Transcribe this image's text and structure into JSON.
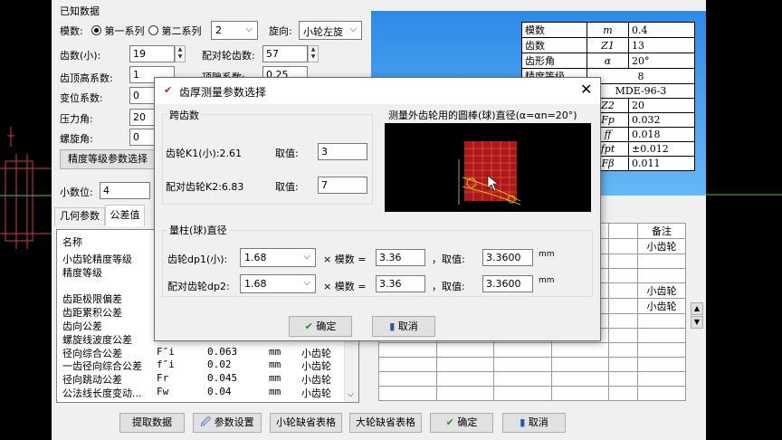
{
  "known_data": {
    "title": "已知数据",
    "module_label": "模数:",
    "series1": "第一系列",
    "series2": "第二系列",
    "module_value": "2",
    "helix_dir_label": "旋向:",
    "helix_dir_value": "小轮左旋",
    "teeth_small_label": "齿数(小):",
    "teeth_small_value": "19",
    "teeth_mating_label": "配对轮齿数:",
    "teeth_mating_value": "57",
    "addendum_label": "齿顶高系数:",
    "addendum_value": "1",
    "tip_clearance_label": "顶隙系数:",
    "tip_clearance_value": "0.25",
    "shift_label": "变位系数:",
    "shift_value": "0",
    "pressure_label": "压力角:",
    "pressure_value": "20",
    "helix_label": "螺旋角:",
    "helix_value": "0",
    "precision_button": "精度等级参数选择",
    "decimals_label": "小数位:",
    "decimals_value": "4"
  },
  "tabs": [
    "几何参数",
    "公差值"
  ],
  "list": {
    "header": "名称",
    "rows": [
      {
        "name": "小齿轮精度等级",
        "sym": "",
        "val": "",
        "unit": "",
        "obj": ""
      },
      {
        "name": "精度等级",
        "sym": "",
        "val": "",
        "unit": "",
        "obj": ""
      },
      {
        "name": "",
        "sym": "",
        "val": "",
        "unit": "",
        "obj": ""
      },
      {
        "name": "齿距极限偏差",
        "sym": "",
        "val": "",
        "unit": "",
        "obj": ""
      },
      {
        "name": "齿距累积公差",
        "sym": "",
        "val": "",
        "unit": "",
        "obj": ""
      },
      {
        "name": "齿向公差",
        "sym": "",
        "val": "",
        "unit": "",
        "obj": ""
      },
      {
        "name": "螺旋线波度公差",
        "sym": "",
        "val": "",
        "unit": "",
        "obj": ""
      },
      {
        "name": "径向综合公差",
        "sym": "F″i",
        "val": "0.063",
        "unit": "mm",
        "obj": "小齿轮"
      },
      {
        "name": "一齿径向综合公差",
        "sym": "f″i",
        "val": "0.02",
        "unit": "mm",
        "obj": "小齿轮"
      },
      {
        "name": "径向跳动公差",
        "sym": "Fr",
        "val": "0.045",
        "unit": "mm",
        "obj": "小齿轮"
      },
      {
        "name": "公法线长度变动...",
        "sym": "Fw",
        "val": "0.04",
        "unit": "mm",
        "obj": "小齿轮"
      }
    ]
  },
  "bottom_buttons": [
    "提取数据",
    "参数设置",
    "小轮缺省表格",
    "大轮缺省表格",
    "确定",
    "取消"
  ],
  "spec_table": [
    [
      "模数",
      "m",
      "0.4"
    ],
    [
      "齿数",
      "Z1",
      "13"
    ],
    [
      "齿形角",
      "α",
      "20°"
    ],
    [
      "精度等级",
      "",
      "8"
    ],
    [
      "",
      "",
      "MDE-96-3"
    ],
    [
      "",
      "Z2",
      "20"
    ],
    [
      "",
      "Fp",
      "0.032"
    ],
    [
      "",
      "ff",
      "0.018"
    ],
    [
      "",
      "fpt",
      "±0.012"
    ],
    [
      "",
      "Fβ",
      "0.011"
    ]
  ],
  "grid_right": {
    "header": "备注",
    "cells": [
      "小齿轮",
      "",
      "小齿轮",
      "小齿轮"
    ]
  },
  "dialog": {
    "title": "齿厚测量参数选择",
    "span_group": "跨齿数",
    "k1_label": "齿轮K1(小):2.61",
    "k1_take": "取值:",
    "k1_value": "3",
    "k2_label": "配对齿轮K2:6.83",
    "k2_take": "取值:",
    "k2_value": "7",
    "pin_caption": "测量外齿轮用的圆棒(球)直径(α=αn=20°)",
    "pin_group": "量柱(球)直径",
    "dp1_label": "齿轮dp1(小):",
    "dp1_value": "1.68",
    "dp2_label": "配对齿轮dp2:",
    "dp2_value": "1.68",
    "times_label": "× 模数 =",
    "module_value1": "3.36",
    "module_value2": "3.36",
    "take_label": "，取值:",
    "take_value1": "3.3600",
    "take_value2": "3.3600",
    "unit": "mm",
    "ok_button": "确定",
    "cancel_button": "取消"
  }
}
